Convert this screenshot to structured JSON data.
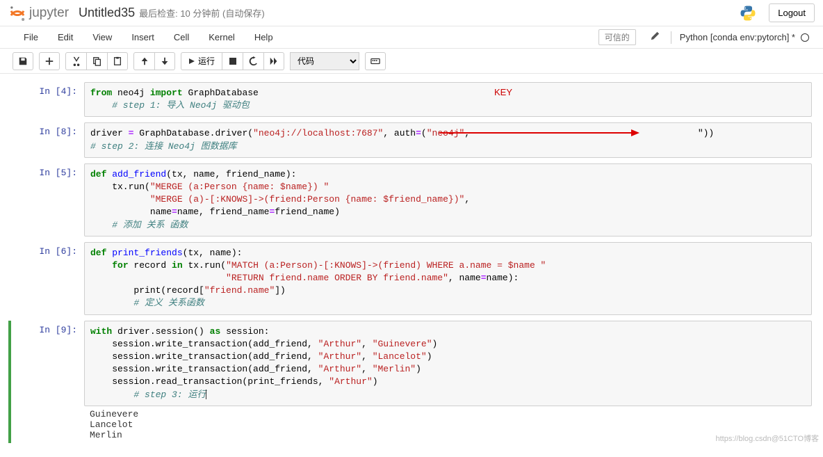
{
  "header": {
    "logo_text": "jupyter",
    "title": "Untitled35",
    "checkpoint": "最后检查: 10 分钟前 (自动保存)",
    "logout": "Logout"
  },
  "menubar": {
    "items": [
      "File",
      "Edit",
      "View",
      "Insert",
      "Cell",
      "Kernel",
      "Help"
    ],
    "trusted": "可信的",
    "kernel": "Python [conda env:pytorch] *"
  },
  "toolbar": {
    "run_label": "运行",
    "cell_type": "代码"
  },
  "annotations": {
    "key_label": "KEY"
  },
  "cells": [
    {
      "prompt": "In  [4]:",
      "code_tokens": [
        {
          "t": "from",
          "c": "kw"
        },
        {
          "t": " neo4j ",
          "c": "nm"
        },
        {
          "t": "import",
          "c": "kw"
        },
        {
          "t": " GraphDatabase",
          "c": "nm"
        },
        {
          "t": "\n",
          "c": "nm"
        },
        {
          "t": "    # step 1: 导入 Neo4j 驱动包",
          "c": "com"
        }
      ],
      "has_key_annotation": true
    },
    {
      "prompt": "In  [8]:",
      "code_tokens": [
        {
          "t": "driver ",
          "c": "nm"
        },
        {
          "t": "=",
          "c": "op"
        },
        {
          "t": " GraphDatabase.driver(",
          "c": "nm"
        },
        {
          "t": "\"neo4j://localhost:7687\"",
          "c": "str"
        },
        {
          "t": ", auth",
          "c": "nm"
        },
        {
          "t": "=",
          "c": "op"
        },
        {
          "t": "(",
          "c": "nm"
        },
        {
          "t": "\"neo4j\"",
          "c": "str"
        },
        {
          "t": ",                                          ",
          "c": "nm"
        },
        {
          "t": "\"))",
          "c": "nm"
        },
        {
          "t": "\n",
          "c": "nm"
        },
        {
          "t": "# step 2: 连接 Neo4j 图数据库",
          "c": "com"
        }
      ],
      "has_arrow": true
    },
    {
      "prompt": "In  [5]:",
      "code_tokens": [
        {
          "t": "def",
          "c": "kw"
        },
        {
          "t": " ",
          "c": "nm"
        },
        {
          "t": "add_friend",
          "c": "fn"
        },
        {
          "t": "(tx, name, friend_name):",
          "c": "nm"
        },
        {
          "t": "\n",
          "c": "nm"
        },
        {
          "t": "    tx.run(",
          "c": "nm"
        },
        {
          "t": "\"MERGE (a:Person {name: $name}) \"",
          "c": "str"
        },
        {
          "t": "\n",
          "c": "nm"
        },
        {
          "t": "           ",
          "c": "nm"
        },
        {
          "t": "\"MERGE (a)-[:KNOWS]->(friend:Person {name: $friend_name})\"",
          "c": "str"
        },
        {
          "t": ",",
          "c": "nm"
        },
        {
          "t": "\n",
          "c": "nm"
        },
        {
          "t": "           name",
          "c": "nm"
        },
        {
          "t": "=",
          "c": "op"
        },
        {
          "t": "name, friend_name",
          "c": "nm"
        },
        {
          "t": "=",
          "c": "op"
        },
        {
          "t": "friend_name)",
          "c": "nm"
        },
        {
          "t": "\n",
          "c": "nm"
        },
        {
          "t": "    # 添加 关系 函数",
          "c": "com"
        }
      ]
    },
    {
      "prompt": "In  [6]:",
      "code_tokens": [
        {
          "t": "def",
          "c": "kw"
        },
        {
          "t": " ",
          "c": "nm"
        },
        {
          "t": "print_friends",
          "c": "fn"
        },
        {
          "t": "(tx, name):",
          "c": "nm"
        },
        {
          "t": "\n",
          "c": "nm"
        },
        {
          "t": "    ",
          "c": "nm"
        },
        {
          "t": "for",
          "c": "kw"
        },
        {
          "t": " record ",
          "c": "nm"
        },
        {
          "t": "in",
          "c": "kw"
        },
        {
          "t": " tx.run(",
          "c": "nm"
        },
        {
          "t": "\"MATCH (a:Person)-[:KNOWS]->(friend) WHERE a.name = $name \"",
          "c": "str"
        },
        {
          "t": "\n",
          "c": "nm"
        },
        {
          "t": "                         ",
          "c": "nm"
        },
        {
          "t": "\"RETURN friend.name ORDER BY friend.name\"",
          "c": "str"
        },
        {
          "t": ", name",
          "c": "nm"
        },
        {
          "t": "=",
          "c": "op"
        },
        {
          "t": "name):",
          "c": "nm"
        },
        {
          "t": "\n",
          "c": "nm"
        },
        {
          "t": "        print(record[",
          "c": "nm"
        },
        {
          "t": "\"friend.name\"",
          "c": "str"
        },
        {
          "t": "])",
          "c": "nm"
        },
        {
          "t": "\n",
          "c": "nm"
        },
        {
          "t": "        # 定义 关系函数",
          "c": "com"
        }
      ]
    },
    {
      "prompt": "In  [9]:",
      "active": true,
      "code_tokens": [
        {
          "t": "with",
          "c": "kw"
        },
        {
          "t": " driver.session() ",
          "c": "nm"
        },
        {
          "t": "as",
          "c": "kw"
        },
        {
          "t": " session:",
          "c": "nm"
        },
        {
          "t": "\n",
          "c": "nm"
        },
        {
          "t": "    session.write_transaction(add_friend, ",
          "c": "nm"
        },
        {
          "t": "\"Arthur\"",
          "c": "str"
        },
        {
          "t": ", ",
          "c": "nm"
        },
        {
          "t": "\"Guinevere\"",
          "c": "str"
        },
        {
          "t": ")",
          "c": "nm"
        },
        {
          "t": "\n",
          "c": "nm"
        },
        {
          "t": "    session.write_transaction(add_friend, ",
          "c": "nm"
        },
        {
          "t": "\"Arthur\"",
          "c": "str"
        },
        {
          "t": ", ",
          "c": "nm"
        },
        {
          "t": "\"Lancelot\"",
          "c": "str"
        },
        {
          "t": ")",
          "c": "nm"
        },
        {
          "t": "\n",
          "c": "nm"
        },
        {
          "t": "    session.write_transaction(add_friend, ",
          "c": "nm"
        },
        {
          "t": "\"Arthur\"",
          "c": "str"
        },
        {
          "t": ", ",
          "c": "nm"
        },
        {
          "t": "\"Merlin\"",
          "c": "str"
        },
        {
          "t": ")",
          "c": "nm"
        },
        {
          "t": "\n",
          "c": "nm"
        },
        {
          "t": "    session.read_transaction(print_friends, ",
          "c": "nm"
        },
        {
          "t": "\"Arthur\"",
          "c": "str"
        },
        {
          "t": ")",
          "c": "nm"
        },
        {
          "t": "\n",
          "c": "nm"
        },
        {
          "t": "        # step 3: 运行",
          "c": "com"
        }
      ],
      "cursor_after": true,
      "output": "Guinevere\nLancelot\nMerlin"
    }
  ],
  "watermark": "https://blog.csdn@51CTO博客"
}
